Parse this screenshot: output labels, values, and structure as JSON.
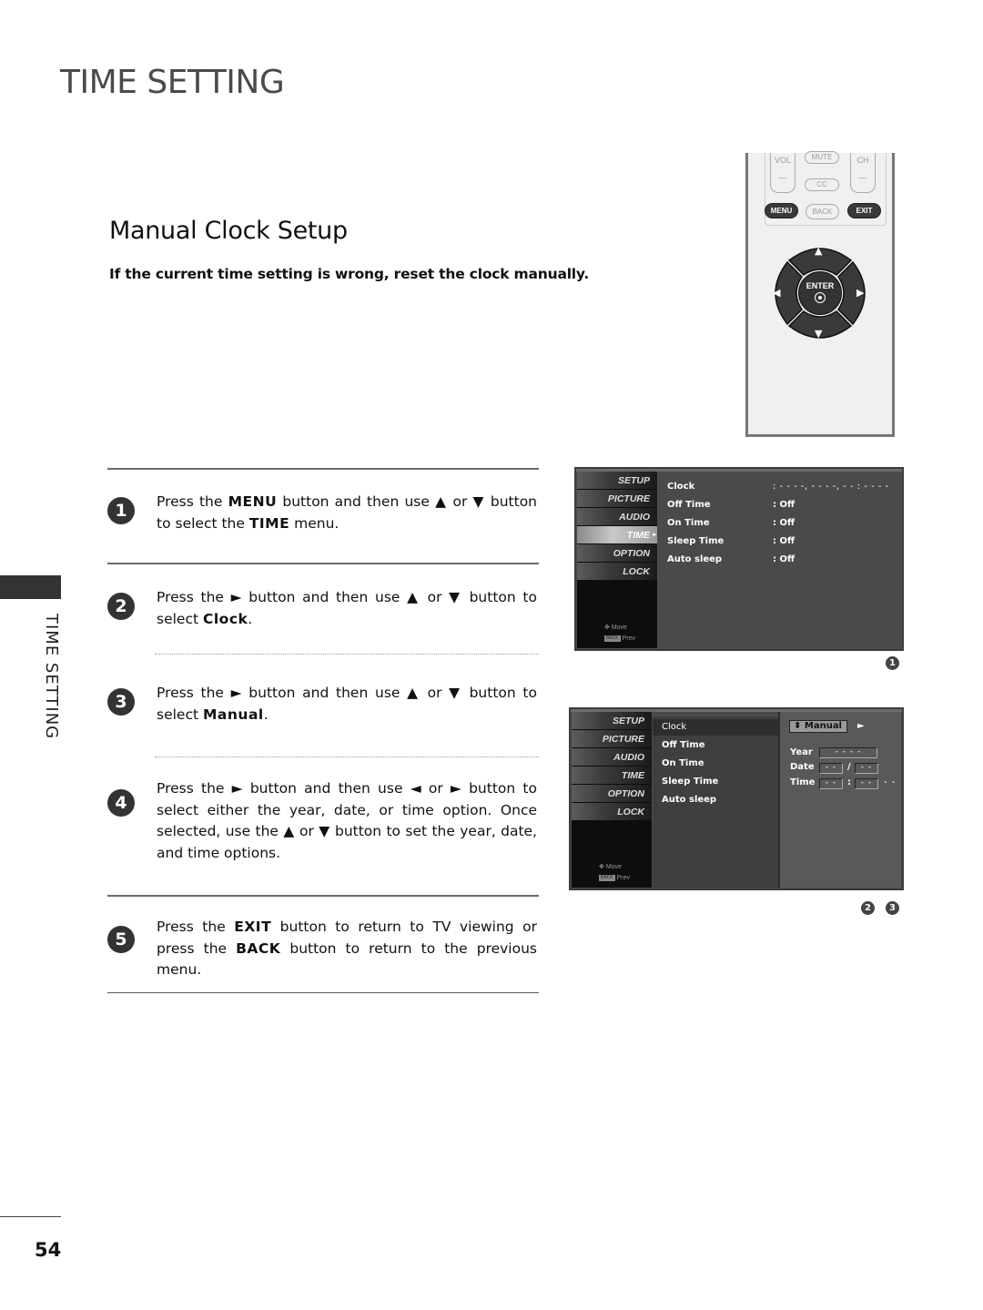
{
  "page": {
    "chapter_title": "TIME SETTING",
    "section_title": "Manual Clock Setup",
    "intro": "If the current time setting is wrong, reset the clock manually.",
    "side_label": "TIME SETTING",
    "page_number": "54"
  },
  "steps": [
    {
      "num": "1",
      "parts": [
        [
          "t",
          "Press the "
        ],
        [
          "b",
          "MENU"
        ],
        [
          "t",
          " button and then use ▲ or ▼ button to select the "
        ],
        [
          "b",
          "TIME"
        ],
        [
          "t",
          " menu."
        ]
      ]
    },
    {
      "num": "2",
      "parts": [
        [
          "t",
          "Press the ► button and then use ▲ or ▼ button to select "
        ],
        [
          "b",
          "Clock"
        ],
        [
          "t",
          "."
        ]
      ]
    },
    {
      "num": "3",
      "parts": [
        [
          "t",
          "Press the ► button and then use ▲ or ▼ button to select "
        ],
        [
          "b",
          "Manual"
        ],
        [
          "t",
          "."
        ]
      ]
    },
    {
      "num": "4",
      "parts": [
        [
          "t",
          "Press the ► button and then use ◄ or ► button to select either the year, date, or time option. Once selected, use the  ▲ or ▼ button to set the year, date, and time options."
        ]
      ]
    },
    {
      "num": "5",
      "parts": [
        [
          "t",
          "Press the "
        ],
        [
          "b",
          "EXIT"
        ],
        [
          "t",
          " button to return to TV viewing or press the "
        ],
        [
          "b",
          "BACK"
        ],
        [
          "t",
          " button to return to the previous menu."
        ]
      ]
    }
  ],
  "remote": {
    "vol": "VOL",
    "mute": "MUTE",
    "ch": "CH",
    "minus": "—",
    "cc": "CC",
    "menu": "MENU",
    "back": "BACK",
    "exit": "EXIT",
    "enter": "ENTER",
    "up": "▲",
    "down": "▼",
    "left": "◀",
    "right": "▶"
  },
  "osd_nav": {
    "items": [
      "SETUP",
      "PICTURE",
      "AUDIO",
      "TIME",
      "OPTION",
      "LOCK"
    ],
    "active": "TIME",
    "active_arrow": "▸",
    "move_icon": "✥",
    "move_label": "Move",
    "back_chip": "BACK",
    "prev_label": "Prev"
  },
  "osd1": {
    "rows": [
      {
        "label": "Clock",
        "value": ": - -  - -, - - - -, - - : - -  - -"
      },
      {
        "label": "Off Time",
        "value": ": Off"
      },
      {
        "label": "On Time",
        "value": ": Off"
      },
      {
        "label": "Sleep Time",
        "value": ": Off"
      },
      {
        "label": "Auto sleep",
        "value": ": Off"
      }
    ],
    "badge": "1"
  },
  "osd2": {
    "rows": [
      "Clock",
      "Off Time",
      "On Time",
      "Sleep Time",
      "Auto sleep"
    ],
    "selected": "Clock",
    "mode_icon": "⬍",
    "mode_value": "Manual",
    "mode_arrow": "►",
    "year_label": "Year",
    "year_value": "- - - -",
    "date_label": "Date",
    "date_month": "- -",
    "date_sep": "/",
    "date_day": "- -",
    "time_label": "Time",
    "time_hour": "- -",
    "time_sep": ":",
    "time_min": "- -",
    "time_ampm": "- -",
    "badges": [
      "2",
      "3"
    ]
  }
}
